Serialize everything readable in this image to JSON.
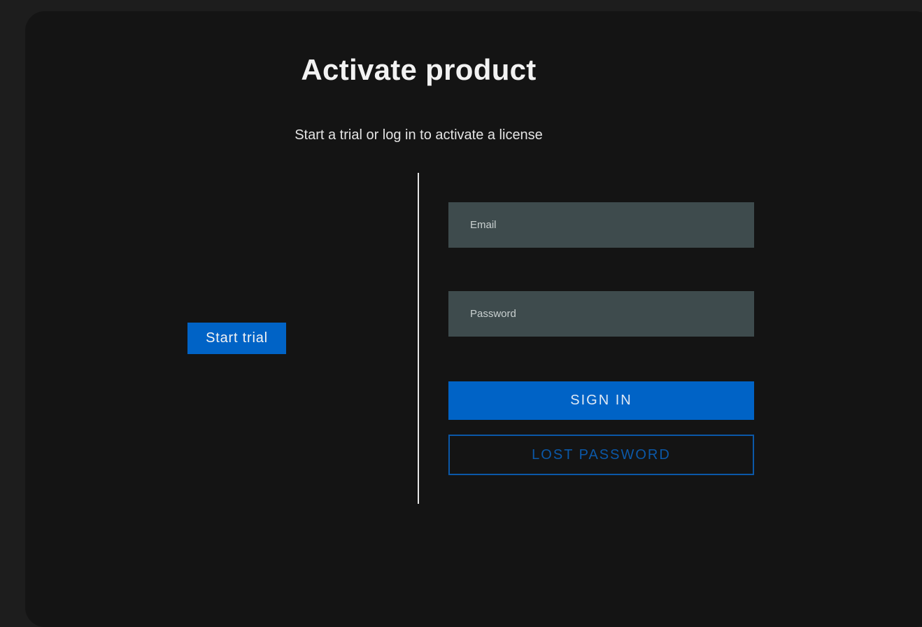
{
  "header": {
    "title": "Activate product",
    "subtitle": "Start a trial or log in to activate a license"
  },
  "trial": {
    "button_label": "Start trial"
  },
  "login": {
    "email_placeholder": "Email",
    "password_placeholder": "Password",
    "sign_in_label": "SIGN IN",
    "lost_password_label": "LOST PASSWORD"
  },
  "colors": {
    "background": "#141414",
    "accent": "#0063c6",
    "input_background": "#3e4b4d",
    "outline_button": "#0b58a8"
  }
}
